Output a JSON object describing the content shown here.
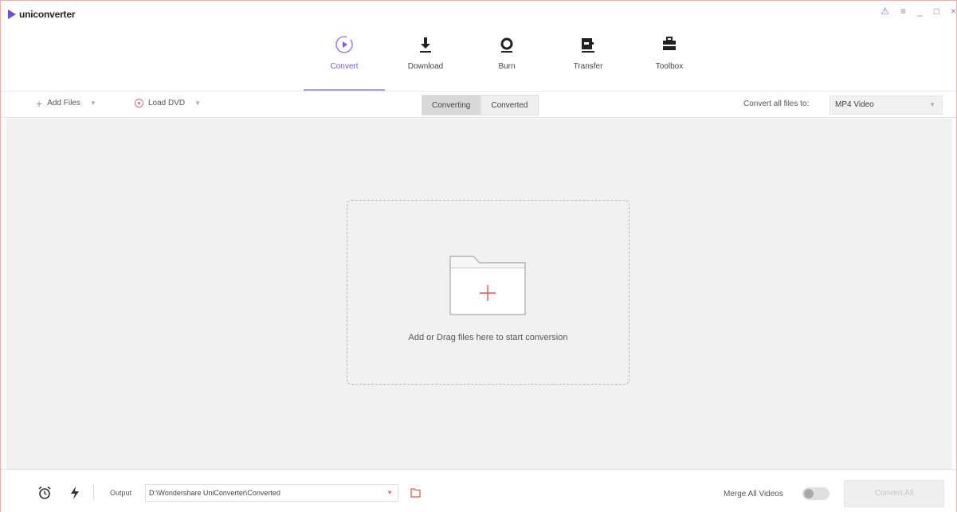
{
  "app": {
    "title": "uniconverter"
  },
  "window_controls": {
    "user": "⚠",
    "menu": "≡",
    "minimize": "_",
    "restore": "□",
    "close": "×"
  },
  "nav": {
    "items": [
      {
        "label": "Convert",
        "icon": "convert-icon",
        "active": true
      },
      {
        "label": "Download",
        "icon": "download-icon",
        "active": false
      },
      {
        "label": "Burn",
        "icon": "burn-icon",
        "active": false
      },
      {
        "label": "Transfer",
        "icon": "transfer-icon",
        "active": false
      },
      {
        "label": "Toolbox",
        "icon": "toolbox-icon",
        "active": false
      }
    ]
  },
  "toolbar": {
    "add_files": "Add Files",
    "load_dvd": "Load DVD",
    "tabs": [
      "Converting",
      "Converted"
    ],
    "active_tab": "Converting",
    "convert_all_label": "Convert all files to:",
    "format_value": "MP4 Video"
  },
  "main": {
    "drop_text": "Add or Drag files here to start conversion"
  },
  "footer": {
    "output_label": "Output",
    "output_path": "D:\\Wondershare UniConverter\\Converted",
    "merge_label": "Merge All Videos",
    "merge_enabled": false,
    "convert_all_button": "Convert All"
  },
  "colors": {
    "accent": "#7b5de0",
    "dvd_red": "#e07070",
    "plus_red": "#e8534a",
    "background": "#f1f1f1"
  }
}
